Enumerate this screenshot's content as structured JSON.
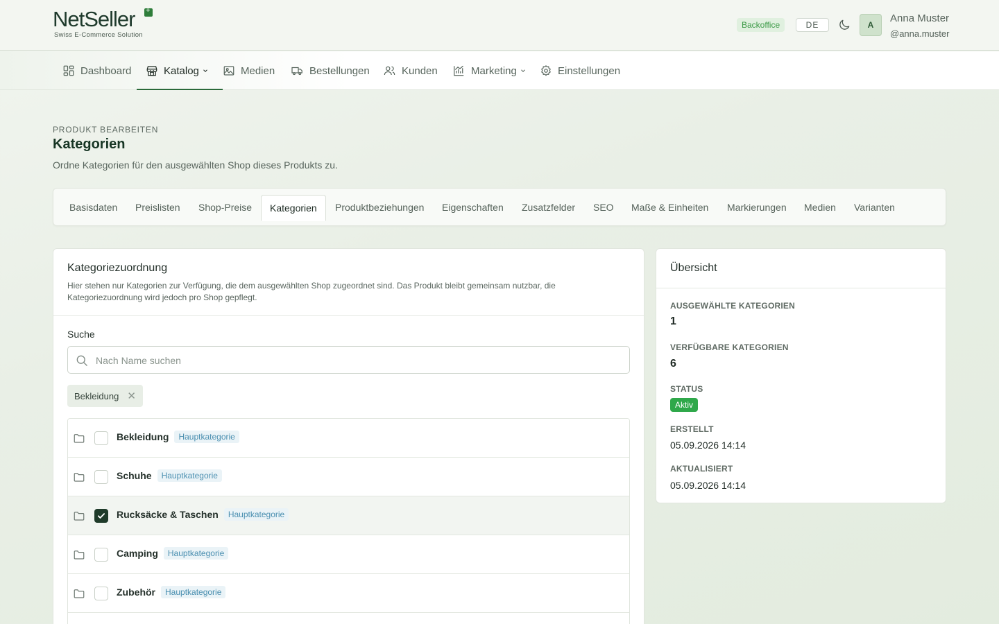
{
  "brand": {
    "name": "NetSeller",
    "tagline": "Swiss E-Commerce Solution"
  },
  "header": {
    "badge": "Backoffice",
    "language": "DE",
    "user": {
      "initial": "A",
      "name": "Anna Muster",
      "handle": "@anna.muster"
    }
  },
  "nav": {
    "dashboard": "Dashboard",
    "katalog": "Katalog",
    "medien": "Medien",
    "bestellungen": "Bestellungen",
    "kunden": "Kunden",
    "marketing": "Marketing",
    "einstellungen": "Einstellungen"
  },
  "page": {
    "eyebrow": "PRODUKT BEARBEITEN",
    "title": "Kategorien",
    "subtitle": "Ordne Kategorien für den ausgewählten Shop dieses Produkts zu."
  },
  "tabs": [
    "Basisdaten",
    "Preislisten",
    "Shop-Preise",
    "Kategorien",
    "Produktbeziehungen",
    "Eigenschaften",
    "Zusatzfelder",
    "SEO",
    "Maße & Einheiten",
    "Markierungen",
    "Medien",
    "Varianten"
  ],
  "assignment": {
    "title": "Kategoriezuordnung",
    "description": "Hier stehen nur Kategorien zur Verfügung, die dem ausgewählten Shop zugeordnet sind. Das Produkt bleibt gemeinsam nutzbar, die Kategoriezuordnung wird jedoch pro Shop gepflegt.",
    "search_label": "Suche",
    "search_placeholder": "Nach Name suchen",
    "chip": "Bekleidung",
    "categories": [
      {
        "name": "Bekleidung",
        "tag": "Hauptkategorie",
        "checked": false
      },
      {
        "name": "Schuhe",
        "tag": "Hauptkategorie",
        "checked": false
      },
      {
        "name": "Rucksäcke & Taschen",
        "tag": "Hauptkategorie",
        "checked": true
      },
      {
        "name": "Camping",
        "tag": "Hauptkategorie",
        "checked": false
      },
      {
        "name": "Zubehör",
        "tag": "Hauptkategorie",
        "checked": false
      }
    ]
  },
  "overview": {
    "title": "Übersicht",
    "selected_label": "AUSGEWÄHLTE KATEGORIEN",
    "selected_value": "1",
    "available_label": "VERFÜGBARE KATEGORIEN",
    "available_value": "6",
    "status_label": "STATUS",
    "status_value": "Aktiv",
    "created_label": "ERSTELLT",
    "created_value": "05.09.2026 14:14",
    "updated_label": "AKTUALISIERT",
    "updated_value": "05.09.2026 14:14"
  },
  "colors": {
    "accent": "#2b6a3a",
    "status_active": "#2fa84a",
    "tag_text": "#4a8fb0"
  }
}
